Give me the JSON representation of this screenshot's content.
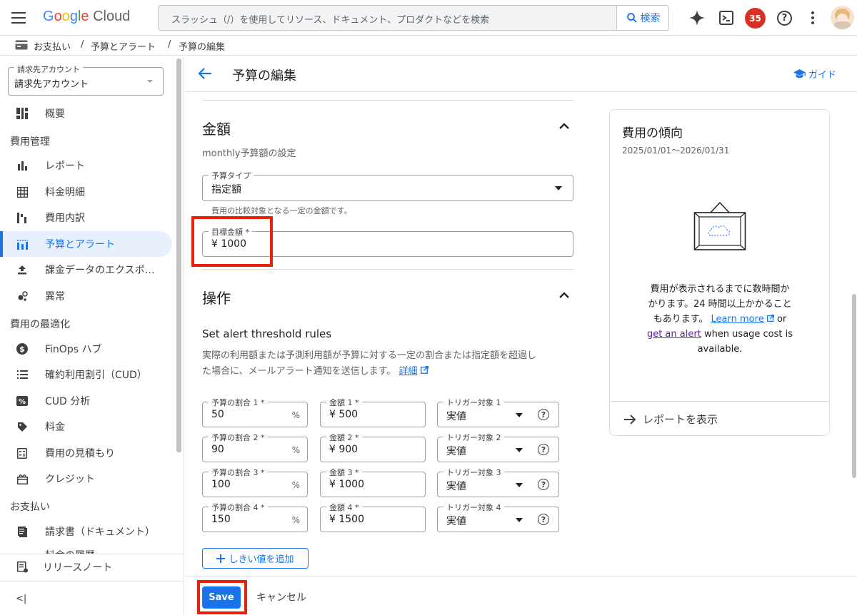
{
  "header": {
    "logo": "Google Cloud",
    "search_placeholder": "スラッシュ（/）を使用してリソース、ドキュメント、プロダクトなどを検索",
    "search_button": "検索",
    "notification_count": "35"
  },
  "breadcrumb": {
    "items": [
      "お支払い",
      "予算とアラート",
      "予算の編集"
    ],
    "separator": "/"
  },
  "sidebar": {
    "account_label": "請求先アカウント",
    "account_value": "請求先アカウント",
    "overview": "概要",
    "section_cost": "費用管理",
    "reports": "レポート",
    "billing_details": "料金明細",
    "cost_breakdown": "費用内訳",
    "budgets_alerts": "予算とアラート",
    "export": "課金データのエクスポ…",
    "anomalies": "異常",
    "section_optimization": "費用の最適化",
    "finops": "FinOps ハブ",
    "cud": "確約利用割引（CUD）",
    "cud_analysis": "CUD 分析",
    "pricing": "料金",
    "estimate": "費用の見積もり",
    "credits": "クレジット",
    "section_payment": "お支払い",
    "invoices": "請求書（ドキュメント）",
    "partial": "料金の履歴",
    "release_notes": "リリースノート",
    "collapse": "<|"
  },
  "page": {
    "title": "予算の編集",
    "guide": "ガイド"
  },
  "amount": {
    "section_title": "金額",
    "subtitle": "monthly予算額の設定",
    "budget_type_label": "予算タイプ",
    "budget_type_value": "指定額",
    "budget_type_help": "費用の比較対象となる一定の金額です。",
    "target_label": "目標金額 *",
    "target_value": "¥ 1000"
  },
  "actions": {
    "section_title": "操作",
    "rules_title": "Set alert threshold rules",
    "rules_desc_1": "実際の利用額または予測利用額が予算に対する一定の割合または指定額を超過し",
    "rules_desc_2": "た場合に、メールアラート通知を送信します。",
    "details_link": "詳細",
    "percent_suffix": "%",
    "rules": [
      {
        "pct_label": "予算の割合 1 *",
        "pct": "50",
        "amt_label": "金額 1 *",
        "amt": "¥ 500",
        "trig_label": "トリガー対象 1",
        "trig": "実値"
      },
      {
        "pct_label": "予算の割合 2 *",
        "pct": "90",
        "amt_label": "金額 2 *",
        "amt": "¥ 900",
        "trig_label": "トリガー対象 2",
        "trig": "実値"
      },
      {
        "pct_label": "予算の割合 3 *",
        "pct": "100",
        "amt_label": "金額 3 *",
        "amt": "¥ 1000",
        "trig_label": "トリガー対象 3",
        "trig": "実値"
      },
      {
        "pct_label": "予算の割合 4 *",
        "pct": "150",
        "amt_label": "金額 4 *",
        "amt": "¥ 1500",
        "trig_label": "トリガー対象 4",
        "trig": "実値"
      }
    ],
    "add_threshold": "しきい値を追加"
  },
  "trend": {
    "title": "費用の傾向",
    "range": "2025/01/01〜2026/01/31",
    "msg_1": "費用が表示されるまでに数時間か",
    "msg_2": "かります。24 時間以上かかること",
    "msg_3": "もあります。",
    "learn_more": "Learn more",
    "or": "or",
    "get_alert": "get an alert",
    "msg_4": "when usage cost is",
    "msg_5": "available.",
    "view_report": "レポートを表示"
  },
  "footer": {
    "save": "Save",
    "cancel": "キャンセル"
  },
  "colors": {
    "accent": "#1a73e8",
    "highlight": "#e8210d",
    "badge": "#d93025"
  }
}
